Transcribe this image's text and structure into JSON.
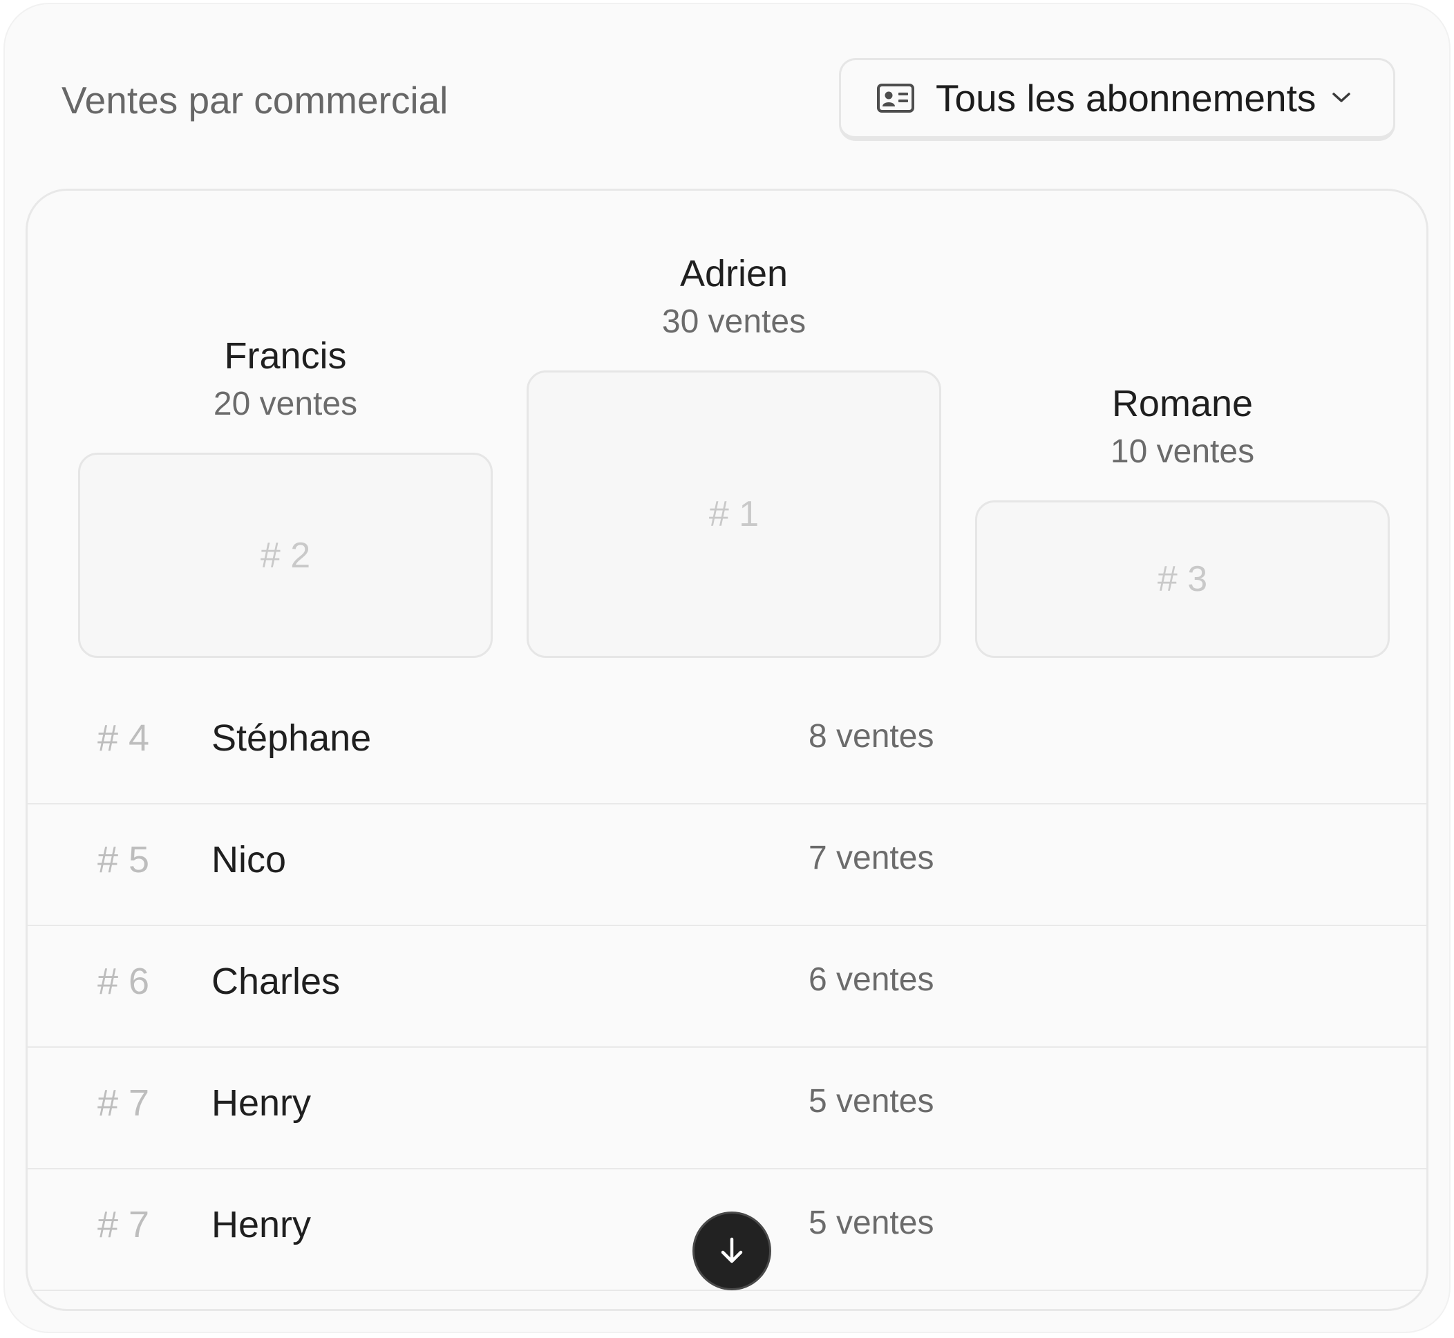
{
  "header": {
    "title": "Ventes par commercial",
    "filter": {
      "label": "Tous les abonnements",
      "icon": "id-card-icon",
      "caret_icon": "chevron-down-icon"
    }
  },
  "podium": {
    "first": {
      "name": "Adrien",
      "sales": "30 ventes",
      "rank": "# 1"
    },
    "second": {
      "name": "Francis",
      "sales": "20 ventes",
      "rank": "# 2"
    },
    "third": {
      "name": "Romane",
      "sales": "10 ventes",
      "rank": "# 3"
    }
  },
  "ranking": [
    {
      "rank": "# 4",
      "name": "Stéphane",
      "sales": "8 ventes"
    },
    {
      "rank": "# 5",
      "name": "Nico",
      "sales": "7 ventes"
    },
    {
      "rank": "# 6",
      "name": "Charles",
      "sales": "6 ventes"
    },
    {
      "rank": "# 7",
      "name": "Henry",
      "sales": "5 ventes"
    },
    {
      "rank": "# 7",
      "name": "Henry",
      "sales": "5 ventes"
    }
  ],
  "scroll_button": {
    "icon": "arrow-down-icon"
  }
}
